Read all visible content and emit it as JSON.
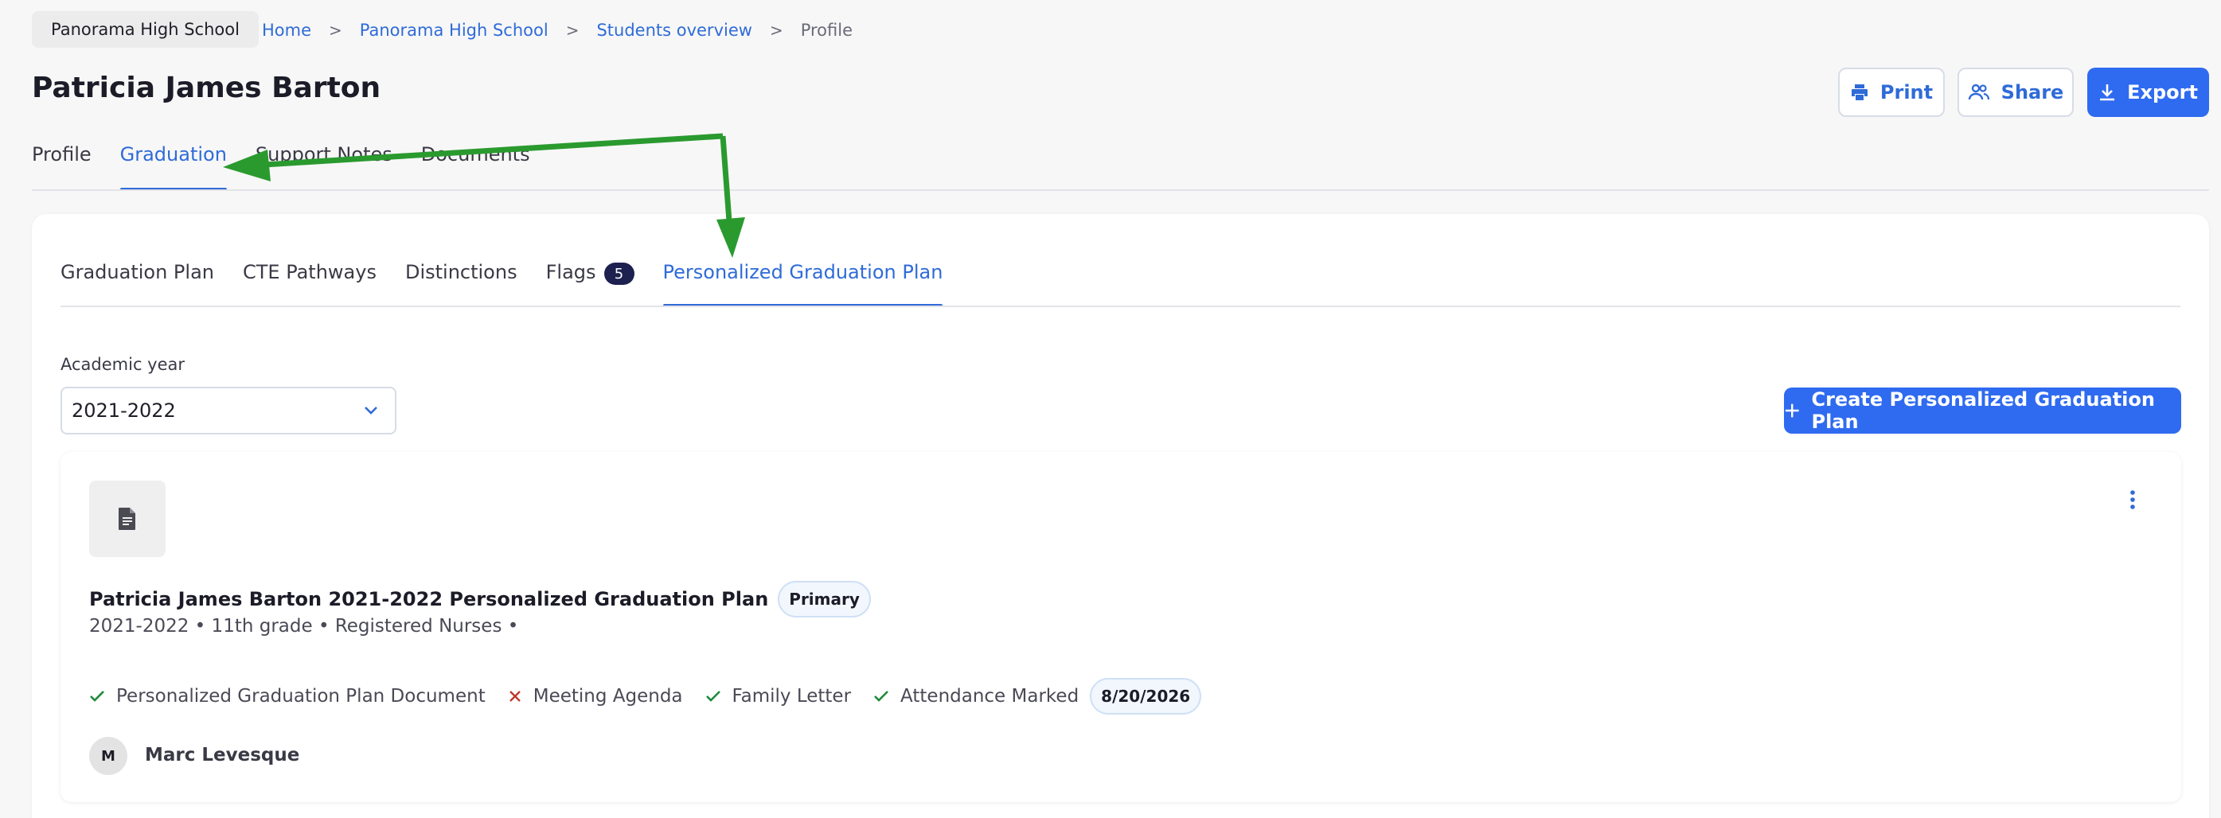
{
  "header": {
    "school_chip": "Panorama High School",
    "breadcrumb": [
      {
        "label": "Home"
      },
      {
        "label": "Panorama High School"
      },
      {
        "label": "Students overview"
      },
      {
        "label": "Profile"
      }
    ],
    "breadcrumb_separator": ">",
    "title": "Patricia James Barton",
    "actions": {
      "print": "Print",
      "share": "Share",
      "export": "Export"
    }
  },
  "main_tabs": [
    {
      "label": "Profile",
      "active": false
    },
    {
      "label": "Graduation",
      "active": true
    },
    {
      "label": "Support Notes",
      "active": false
    },
    {
      "label": "Documents",
      "active": false
    }
  ],
  "sub_tabs": [
    {
      "label": "Graduation Plan",
      "active": false
    },
    {
      "label": "CTE Pathways",
      "active": false
    },
    {
      "label": "Distinctions",
      "active": false
    },
    {
      "label": "Flags",
      "count": "5",
      "active": false
    },
    {
      "label": "Personalized Graduation Plan",
      "active": true
    }
  ],
  "academic_year": {
    "label": "Academic year",
    "value": "2021-2022"
  },
  "create_button": "Create Personalized Graduation Plan",
  "plan": {
    "title": "Patricia James Barton 2021-2022 Personalized Graduation Plan",
    "badge": "Primary",
    "meta": "2021-2022 • 11th grade • Registered Nurses •",
    "checklist": [
      {
        "label": "Personalized Graduation Plan Document",
        "status": "done"
      },
      {
        "label": "Meeting Agenda",
        "status": "missing"
      },
      {
        "label": "Family Letter",
        "status": "done"
      },
      {
        "label": "Attendance Marked",
        "status": "done"
      }
    ],
    "date": "8/20/2026",
    "owner": {
      "initial": "M",
      "name": "Marc Levesque"
    }
  },
  "colors": {
    "accent": "#2f6bf0",
    "link": "#2f6bd8",
    "check": "#1f8a3c",
    "cross": "#c0392b",
    "annotation_arrow": "#2a9a2f"
  }
}
